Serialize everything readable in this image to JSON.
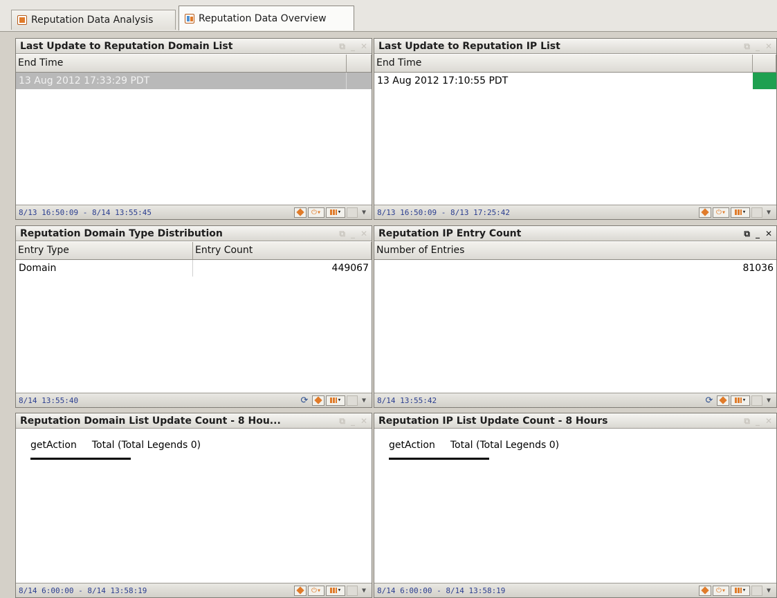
{
  "tabs": [
    {
      "label": "Reputation Data Analysis",
      "icon": "report-icon",
      "active": false
    },
    {
      "label": "Reputation Data Overview",
      "icon": "dashboard-icon",
      "active": true
    }
  ],
  "panels": {
    "domain_update": {
      "title": "Last Update to Reputation Domain List",
      "columns": [
        "End Time",
        ""
      ],
      "rows": [
        [
          "13 Aug 2012 17:33:29 PDT"
        ]
      ],
      "selected_row": 0,
      "footer_range": "8/13 16:50:09 - 8/14 13:55:45"
    },
    "ip_update": {
      "title": "Last Update to Reputation IP List",
      "columns": [
        "End Time",
        ""
      ],
      "rows": [
        [
          "13 Aug 2012 17:10:55 PDT"
        ]
      ],
      "status_color": "#1ea050",
      "footer_range": "8/13 16:50:09 - 8/13 17:25:42"
    },
    "domain_type": {
      "title": "Reputation Domain Type Distribution",
      "columns": [
        "Entry Type",
        "Entry Count"
      ],
      "rows": [
        [
          "Domain",
          "449067"
        ]
      ],
      "footer_range": "8/14 13:55:40"
    },
    "ip_count": {
      "title": "Reputation IP Entry Count",
      "columns": [
        "Number of Entries"
      ],
      "rows": [
        [
          "81036"
        ]
      ],
      "footer_range": "8/14 13:55:42"
    },
    "domain_8h": {
      "title": "Reputation Domain List Update Count - 8 Hou...",
      "legend_key": "getAction",
      "legend_value": "Total (Total Legends 0)",
      "footer_range": "8/14 6:00:00 - 8/14 13:58:19"
    },
    "ip_8h": {
      "title": "Reputation IP List Update Count - 8 Hours",
      "legend_key": "getAction",
      "legend_value": "Total (Total Legends 0)",
      "footer_range": "8/14 6:00:00 - 8/14 13:58:19"
    }
  },
  "colors": {
    "accent_orange": "#e07b2a",
    "selected_row": "#b9b9b9",
    "footer_text": "#2a3d8f"
  }
}
